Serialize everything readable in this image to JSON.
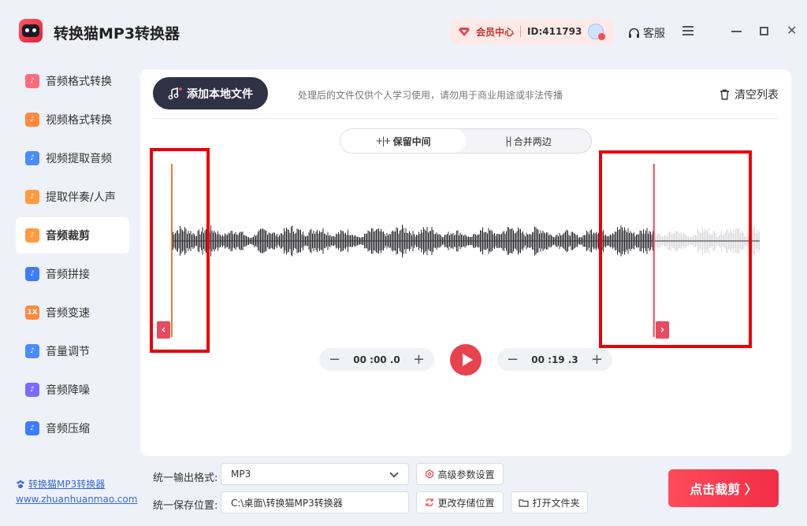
{
  "app": {
    "title": "转换猫MP3转换器"
  },
  "vip": {
    "label": "会员中心",
    "id_text": "ID:411793"
  },
  "header": {
    "support": "客服"
  },
  "sidebar": {
    "items": [
      {
        "label": "音频格式转换",
        "icon": "audio-format-icon",
        "color": "#ff6b7a"
      },
      {
        "label": "视频格式转换",
        "icon": "video-format-icon",
        "color": "#ff8a3d"
      },
      {
        "label": "视频提取音频",
        "icon": "video-extract-icon",
        "color": "#4a8cff"
      },
      {
        "label": "提取伴奏/人声",
        "icon": "vocal-split-icon",
        "color": "#ff9a3d"
      },
      {
        "label": "音频裁剪",
        "icon": "audio-cut-icon",
        "color": "#ff9a3d"
      },
      {
        "label": "音频拼接",
        "icon": "audio-join-icon",
        "color": "#3d7bff"
      },
      {
        "label": "音频变速",
        "icon": "audio-speed-icon",
        "color": "#ff8a3d",
        "glyph": "1X"
      },
      {
        "label": "音量调节",
        "icon": "volume-icon",
        "color": "#4a8cff"
      },
      {
        "label": "音频降噪",
        "icon": "denoise-icon",
        "color": "#7a6bff"
      },
      {
        "label": "音频压缩",
        "icon": "compress-icon",
        "color": "#3d7bff"
      }
    ],
    "active_index": 4
  },
  "footer": {
    "brand": "转换猫MP3转换器",
    "url": "www.zhuanhuanmao.com"
  },
  "toolbar": {
    "add_label": "添加本地文件",
    "notice": "处理后的文件仅供个人学习使用，请勿用于商业用途或非法传播",
    "clear_label": "清空列表"
  },
  "mode": {
    "options": [
      {
        "label": "保留中间",
        "glyph": "+|+"
      },
      {
        "label": "合并两边",
        "glyph": "|-|"
      }
    ],
    "active": 0
  },
  "trim": {
    "start_time": "00 :00 .0",
    "end_time": "00 :19 .3",
    "start_fraction": 0.0,
    "end_fraction": 0.82
  },
  "output": {
    "format_label": "统一输出格式:",
    "format_value": "MP3",
    "advanced_label": "高级参数设置",
    "save_label": "统一保存位置:",
    "save_path": "C:\\桌面\\转换猫MP3转换器",
    "change_location": "更改存储位置",
    "open_folder": "打开文件夹"
  },
  "actions": {
    "cut_label": "点击裁剪 〉"
  },
  "colors": {
    "accent": "#e8424f",
    "dark_button": "#2f3144",
    "annotation": "#e8000b"
  }
}
